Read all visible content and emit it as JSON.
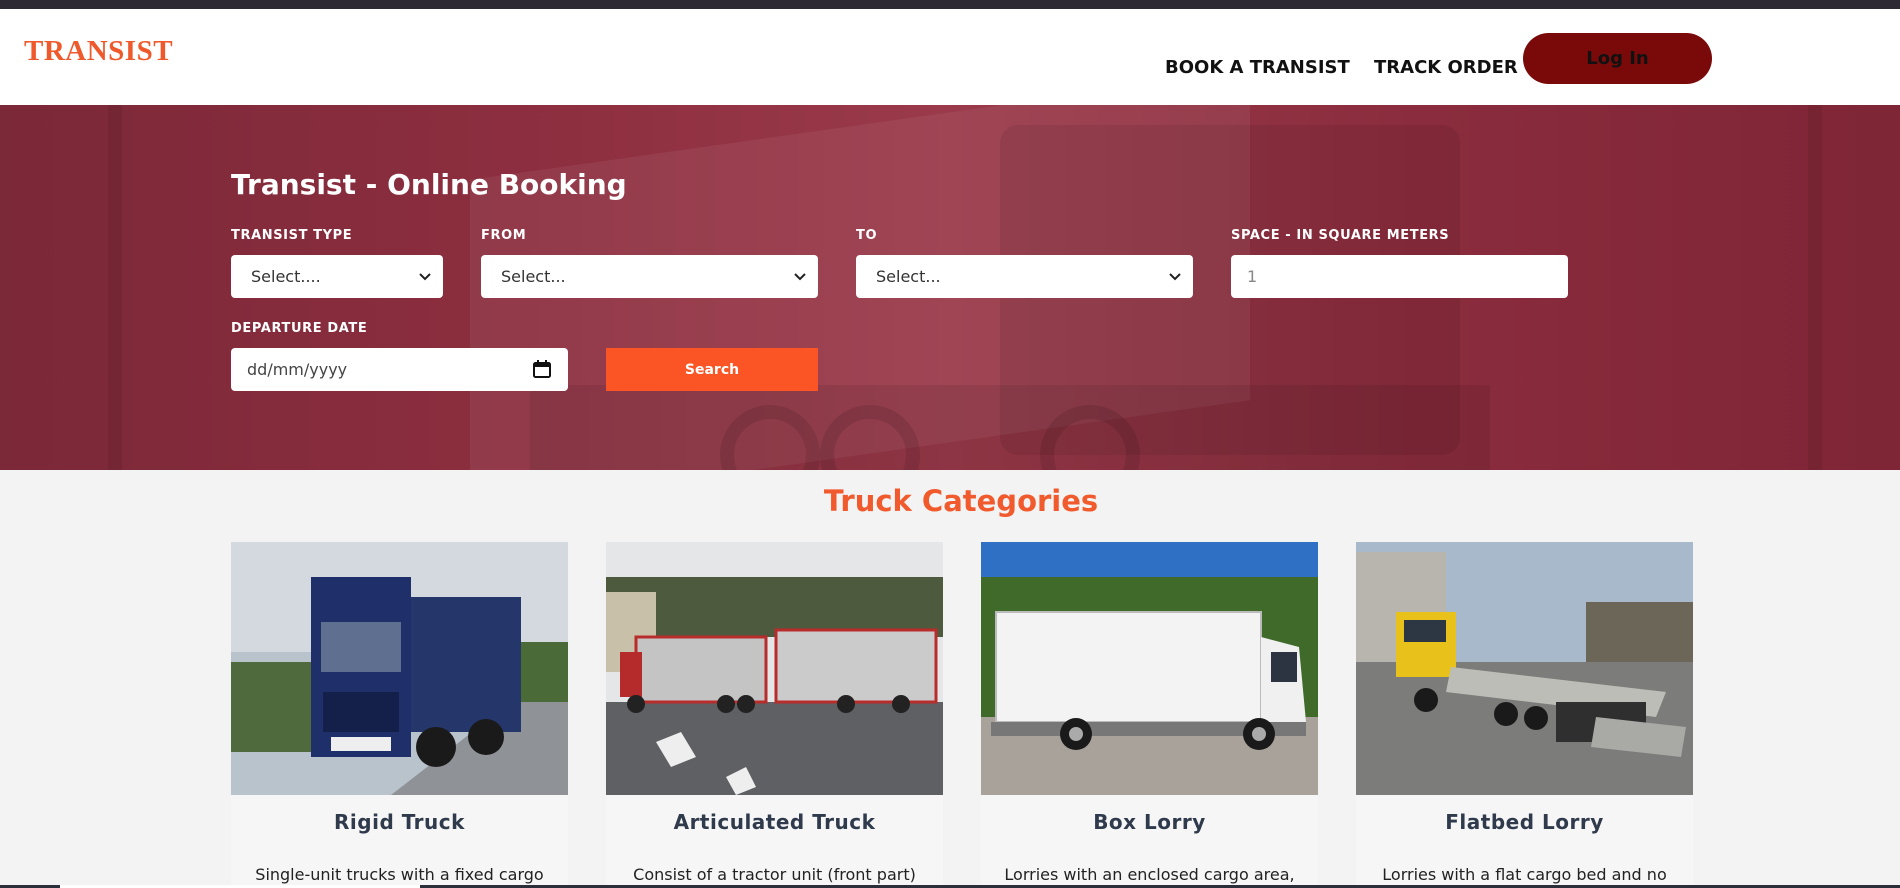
{
  "header": {
    "logo": "TRANSIST",
    "nav": [
      "BOOK A TRANSIST",
      "TRACK ORDER"
    ],
    "login_label": "Log In"
  },
  "booking": {
    "title": "Transist - Online Booking",
    "transist_type": {
      "label": "TRANSIST TYPE",
      "value": "Select...."
    },
    "from": {
      "label": "FROM",
      "value": "Select..."
    },
    "to": {
      "label": "TO",
      "value": "Select..."
    },
    "space": {
      "label": "SPACE - IN SQUARE METERS",
      "placeholder": "1"
    },
    "departure": {
      "label": "DEPARTURE DATE",
      "placeholder": "dd/mm/yyyy"
    },
    "search_label": "Search"
  },
  "categories": {
    "title": "Truck Categories",
    "items": [
      {
        "name": "Rigid Truck",
        "desc": "Single-unit trucks with a fixed cargo"
      },
      {
        "name": "Articulated Truck",
        "desc": "Consist of a tractor unit (front part)"
      },
      {
        "name": "Box Lorry",
        "desc": "Lorries with an enclosed cargo area,"
      },
      {
        "name": "Flatbed Lorry",
        "desc": "Lorries with a flat cargo bed and no"
      }
    ]
  },
  "icons": {
    "select_arrow": "chevron-down-icon",
    "calendar": "calendar-icon"
  },
  "colors": {
    "brand": "#ef5a2d",
    "login_button": "#7a0a0a",
    "hero": "#8e2f40",
    "search_button": "#fb5526",
    "section_title": "#f15a2d"
  }
}
